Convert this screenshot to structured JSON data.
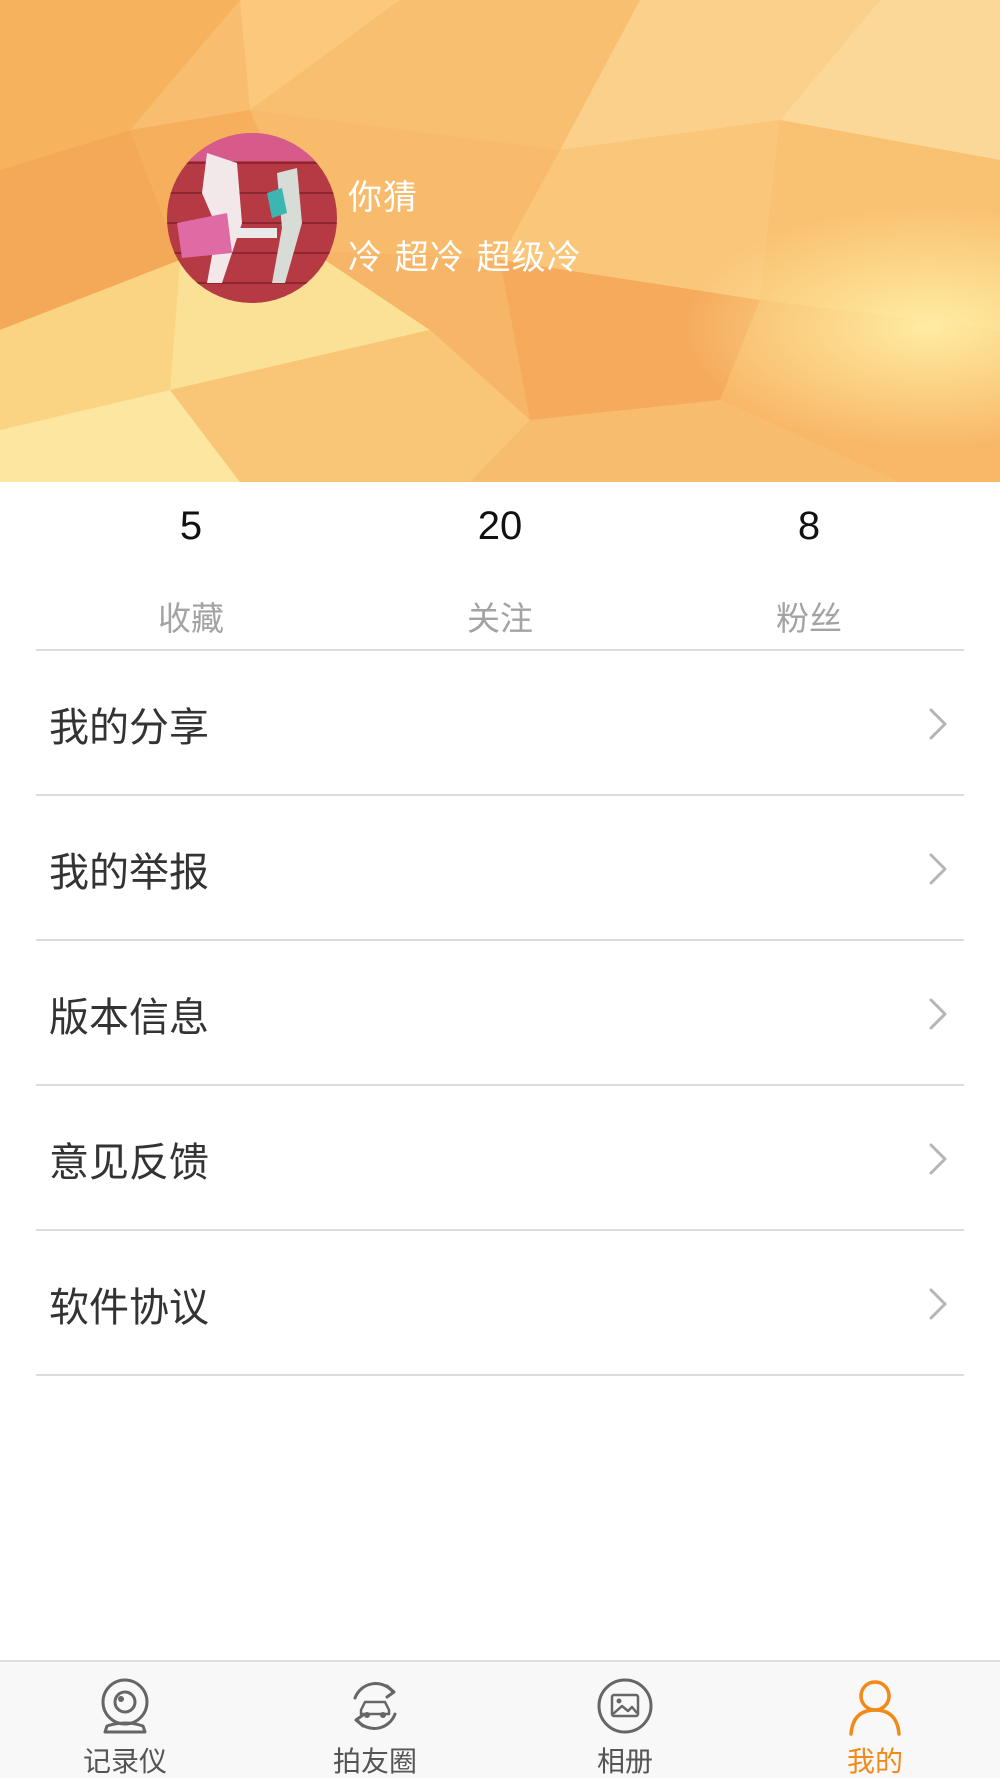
{
  "profile": {
    "username": "你猜",
    "signature": "冷 超冷 超级冷"
  },
  "stats": [
    {
      "value": "5",
      "label": "收藏"
    },
    {
      "value": "20",
      "label": "关注"
    },
    {
      "value": "8",
      "label": "粉丝"
    }
  ],
  "menu": [
    {
      "label": "我的分享"
    },
    {
      "label": "我的举报"
    },
    {
      "label": "版本信息"
    },
    {
      "label": "意见反馈"
    },
    {
      "label": "软件协议"
    }
  ],
  "tabs": [
    {
      "label": "记录仪",
      "icon": "dashcam-icon"
    },
    {
      "label": "拍友圈",
      "icon": "car-share-icon"
    },
    {
      "label": "相册",
      "icon": "photo-album-icon"
    },
    {
      "label": "我的",
      "icon": "person-icon",
      "active": true
    }
  ],
  "colors": {
    "accent": "#f28a19",
    "banner": "#f7b86a",
    "muted_text": "#a3a3a3",
    "divider": "#dcdcdc"
  }
}
